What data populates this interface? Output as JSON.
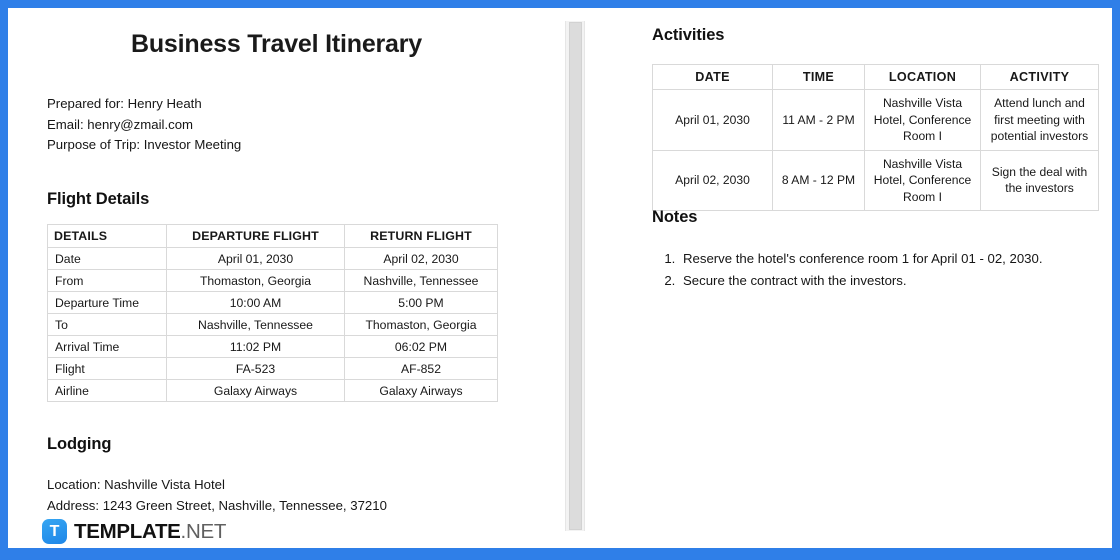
{
  "theme": {
    "border_blue": "#2F7FE8",
    "logo_blue": "#1E86E8",
    "table_border": "#D9D9D9"
  },
  "document": {
    "title": "Business Travel Itinerary",
    "prepared_for": "Prepared for: Henry Heath",
    "email": "Email: henry@zmail.com",
    "purpose": "Purpose of Trip: Investor Meeting"
  },
  "flight_section": {
    "heading": "Flight Details",
    "headers": [
      "DETAILS",
      "DEPARTURE FLIGHT",
      "RETURN FLIGHT"
    ],
    "rows": [
      {
        "label": "Date",
        "departure": "April 01, 2030",
        "return": "April 02, 2030"
      },
      {
        "label": "From",
        "departure": "Thomaston, Georgia",
        "return": "Nashville, Tennessee"
      },
      {
        "label": "Departure Time",
        "departure": "10:00 AM",
        "return": "5:00 PM"
      },
      {
        "label": "To",
        "departure": "Nashville, Tennessee",
        "return": "Thomaston, Georgia"
      },
      {
        "label": "Arrival Time",
        "departure": "11:02 PM",
        "return": "06:02 PM"
      },
      {
        "label": "Flight",
        "departure": "FA-523",
        "return": "AF-852"
      },
      {
        "label": "Airline",
        "departure": "Galaxy Airways",
        "return": "Galaxy Airways"
      }
    ]
  },
  "lodging_section": {
    "heading": "Lodging",
    "location": "Location: Nashville Vista Hotel",
    "address": "Address: 1243 Green Street, Nashville, Tennessee, 37210"
  },
  "activities_section": {
    "heading": "Activities",
    "headers": [
      "DATE",
      "TIME",
      "LOCATION",
      "ACTIVITY"
    ],
    "rows": [
      {
        "date": "April 01, 2030",
        "time": "11 AM - 2 PM",
        "location": "Nashville Vista Hotel, Conference Room I",
        "activity": "Attend lunch and first meeting with potential investors"
      },
      {
        "date": "April 02, 2030",
        "time": "8 AM - 12 PM",
        "location": "Nashville Vista Hotel, Conference Room I",
        "activity": "Sign the deal with the investors"
      }
    ]
  },
  "notes_section": {
    "heading": "Notes",
    "items": [
      "Reserve the hotel's conference room 1 for April 01 - 02, 2030.",
      "Secure the contract with the investors."
    ]
  },
  "branding": {
    "mark": "T",
    "name": "TEMPLATE",
    "tld": ".NET"
  }
}
